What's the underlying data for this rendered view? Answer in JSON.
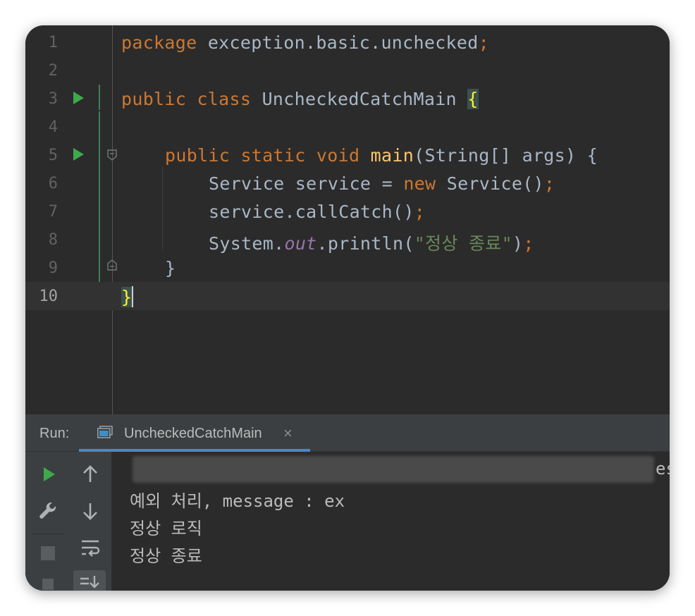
{
  "editor": {
    "line_numbers": [
      "1",
      "2",
      "3",
      "4",
      "5",
      "6",
      "7",
      "8",
      "9",
      "10"
    ],
    "lines": {
      "l1_kw": "package",
      "l1_rest": " exception.basic.unchecked",
      "l1_semi": ";",
      "l3_kw": "public class",
      "l3_name": " UncheckedCatchMain ",
      "l3_brace": "{",
      "l5_kw": "public static void",
      "l5_fn": " main",
      "l5_rest": "(String[] args) {",
      "l6_a": "Service service = ",
      "l6_kw": "new",
      "l6_b": " Service()",
      "l6_semi": ";",
      "l7_a": "service.callCatch()",
      "l7_semi": ";",
      "l8_a": "System.",
      "l8_field": "out",
      "l8_b": ".println(",
      "l8_str": "\"정상 종료\"",
      "l8_c": ")",
      "l8_semi": ";",
      "l9": "}",
      "l10": "}"
    }
  },
  "run_panel": {
    "label": "Run:",
    "tab_title": "UncheckedCatchMain",
    "tab_close": "×",
    "console_lines": [
      "예외 처리, message : ex",
      "정상 로직",
      "정상 종료"
    ],
    "clipped_suffix": "es"
  },
  "icons": {
    "run": "play-icon",
    "wrench": "wrench-icon",
    "stop": "stop-icon",
    "up": "arrow-up-icon",
    "down": "arrow-down-icon",
    "wrap": "soft-wrap-icon",
    "scroll": "scroll-to-end-icon"
  },
  "colors": {
    "keyword": "#cc7832",
    "function": "#ffc66d",
    "string": "#6a8759",
    "field": "#9876aa",
    "run_green": "#3ea94b"
  }
}
